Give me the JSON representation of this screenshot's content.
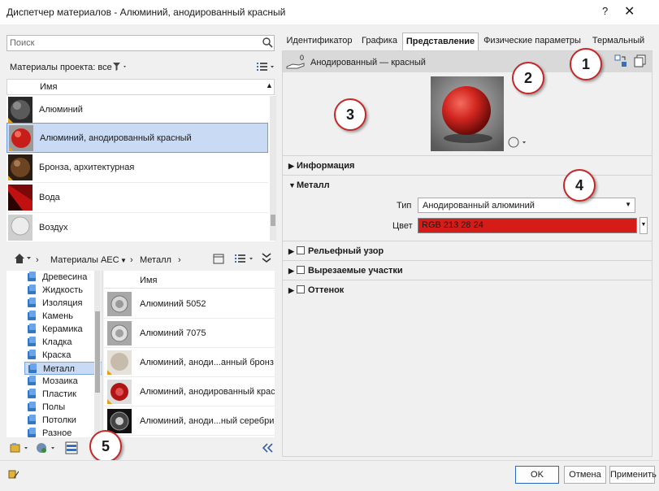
{
  "window": {
    "title": "Диспетчер материалов - Алюминий, анодированный красный",
    "help": "?",
    "close": "✕"
  },
  "search": {
    "placeholder": "Поиск"
  },
  "project_materials": {
    "filter_label": "Материалы проекта: все",
    "column_name": "Имя",
    "items": [
      {
        "label": "Алюминий"
      },
      {
        "label": "Алюминий, анодированный красный"
      },
      {
        "label": "Бронза, архитектурная"
      },
      {
        "label": "Вода"
      },
      {
        "label": "Воздух"
      }
    ]
  },
  "breadcrumb": {
    "items": [
      "Материалы AEC",
      "Металл"
    ]
  },
  "library_tree": {
    "items": [
      "Древесина",
      "Жидкость",
      "Изоляция",
      "Камень",
      "Керамика",
      "Кладка",
      "Краска",
      "Металл",
      "Мозаика",
      "Пластик",
      "Полы",
      "Потолки",
      "Разное"
    ],
    "selected": "Металл"
  },
  "library_grid": {
    "column_name": "Имя",
    "items": [
      {
        "label": "Алюминий 5052"
      },
      {
        "label": "Алюминий 7075"
      },
      {
        "label": "Алюминий, аноди...анный бронз"
      },
      {
        "label": "Алюминий, анодированный крас"
      },
      {
        "label": "Алюминий, аноди...ный серебри"
      }
    ]
  },
  "tabs": [
    {
      "label": "Идентификатор"
    },
    {
      "label": "Графика"
    },
    {
      "label": "Представление",
      "active": true
    },
    {
      "label": "Физические параметры"
    },
    {
      "label": "Термальный"
    }
  ],
  "asset": {
    "count": "0",
    "name": "Анодированный — красный"
  },
  "sections": {
    "info": "Информация",
    "metal": "Металл",
    "relief": "Рельефный узор",
    "cutouts": "Вырезаемые участки",
    "tint": "Оттенок"
  },
  "metal": {
    "type_label": "Тип",
    "type_value": "Анодированный алюминий",
    "color_label": "Цвет",
    "color_value": "RGB 213 28 24",
    "color_hex": "#d51c18"
  },
  "callouts": [
    "1",
    "2",
    "3",
    "4",
    "5"
  ],
  "buttons": {
    "ok": "OK",
    "cancel": "Отмена",
    "apply": "Применить"
  }
}
